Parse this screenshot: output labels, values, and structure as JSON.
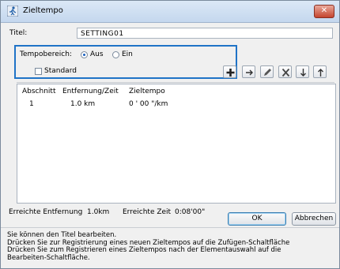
{
  "window": {
    "title": "Zieltempo",
    "close_glyph": "✕"
  },
  "form": {
    "title_label": "Titel:",
    "title_value": "SETTING01",
    "tempo_label": "Tempobereich:",
    "radio_off_label": "Aus",
    "radio_on_label": "Ein",
    "selected": "Aus",
    "standard_label": "Standard",
    "standard_checked": false
  },
  "toolbar": {
    "add": "add-icon",
    "insert": "arrow-right-icon",
    "edit": "pencil-icon",
    "delete": "delete-x-icon",
    "down": "arrow-down-icon",
    "up": "arrow-up-icon"
  },
  "table": {
    "headers": [
      "Abschnitt",
      "Entfernung/Zeit",
      "Zieltempo"
    ],
    "rows": [
      [
        "1",
        "1.0 km",
        "0 ' 00 \"/km"
      ]
    ]
  },
  "footer": {
    "distance_label": "Erreichte Entfernung",
    "distance_value": "1.0km",
    "time_label": "Erreichte Zeit",
    "time_value": "0:08'00\"",
    "ok_label": "OK",
    "cancel_label": "Abbrechen"
  },
  "help_text": "Sie können den Titel bearbeiten.\nDrücken Sie zur Registrierung eines neuen Zieltempos auf die Zufügen-Schaltfläche\nDrücken Sie zum Registrieren eines Zieltempos nach der Elementauswahl auf die\nBearbeiten-Schaltfläche."
}
